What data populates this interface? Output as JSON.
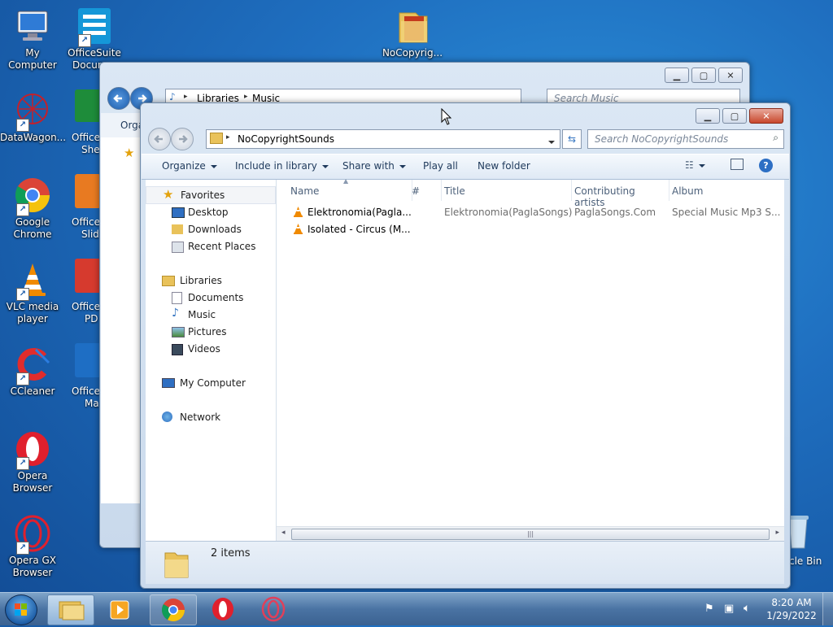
{
  "desktop": {
    "icons": [
      {
        "label": "My Computer"
      },
      {
        "label": "OfficeSuite Docum..."
      },
      {
        "label": "NoCopyrig..."
      },
      {
        "label": "DataWagon..."
      },
      {
        "label": "Google Chrome"
      },
      {
        "label": "VLC media player"
      },
      {
        "label": "CCleaner"
      },
      {
        "label": "Opera Browser"
      },
      {
        "label": "Opera GX Browser"
      },
      {
        "label": "cle Bin"
      }
    ],
    "partial_labels": [
      "Office",
      "Shee",
      "Office",
      "Slid",
      "Office",
      "PD",
      "Office",
      "Ma"
    ]
  },
  "back_window": {
    "breadcrumb": [
      "Libraries",
      "Music"
    ],
    "search_placeholder": "Search Music",
    "organize_label": "Orga"
  },
  "front_window": {
    "breadcrumb": [
      "NoCopyrightSounds"
    ],
    "search_placeholder": "Search NoCopyrightSounds",
    "toolbar": {
      "organize": "Organize",
      "include_in_library": "Include in library",
      "share_with": "Share with",
      "play_all": "Play all",
      "new_folder": "New folder"
    },
    "nav": {
      "favorites": "Favorites",
      "desktop": "Desktop",
      "downloads": "Downloads",
      "recent_places": "Recent Places",
      "libraries": "Libraries",
      "documents": "Documents",
      "music": "Music",
      "pictures": "Pictures",
      "videos": "Videos",
      "my_computer": "My Computer",
      "network": "Network"
    },
    "columns": {
      "name": "Name",
      "number": "#",
      "title": "Title",
      "artists": "Contributing artists",
      "album": "Album"
    },
    "files": [
      {
        "name": "Elektronomia(Pagla...",
        "title": "Elektronomia(PaglaSongs)",
        "artist": "PaglaSongs.Com",
        "album": "Special Music Mp3 S..."
      },
      {
        "name": "Isolated - Circus (M...",
        "title": "",
        "artist": "",
        "album": ""
      }
    ],
    "status": "2 items"
  },
  "clock": {
    "time": "8:20 AM",
    "date": "1/29/2022"
  },
  "colors": {
    "accent": "#1f6fc0",
    "vlc_orange": "#f08a00",
    "opera_red": "#e0202d"
  }
}
